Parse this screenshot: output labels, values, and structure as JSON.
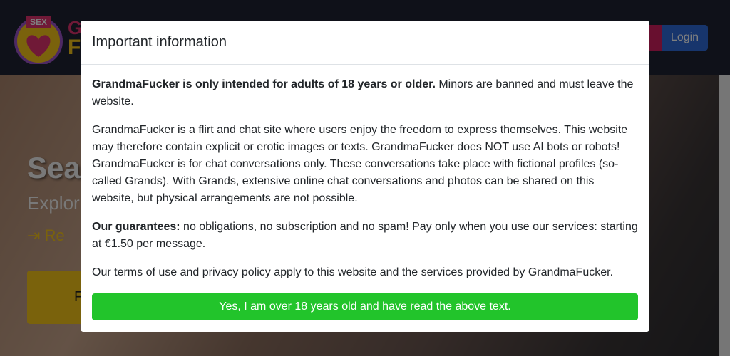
{
  "navbar": {
    "logo_badge": "SEX",
    "logo_text_line1": "G",
    "logo_text_line2": "F",
    "login_label": "Login"
  },
  "hero": {
    "title": "Sea",
    "subtitle": "Explor",
    "register_link": "Re",
    "cta_label": "F"
  },
  "modal": {
    "title": "Important information",
    "para1_bold": "GrandmaFucker is only intended for adults of 18 years or older.",
    "para1_rest": " Minors are banned and must leave the website.",
    "para2": "GrandmaFucker is a flirt and chat site where users enjoy the freedom to express themselves. This website may therefore contain explicit or erotic images or texts. GrandmaFucker does NOT use AI bots or robots! GrandmaFucker is for chat conversations only. These conversations take place with fictional profiles (so-called Grands). With Grands, extensive online chat conversations and photos can be shared on this website, but physical arrangements are not possible.",
    "para3_bold": "Our guarantees:",
    "para3_rest": " no obligations, no subscription and no spam! Pay only when you use our services: starting at €1.50 per message.",
    "para4": "Our terms of use and privacy policy apply to this website and the services provided by GrandmaFucker.",
    "confirm_label": "Yes, I am over 18 years old and have read the above text."
  },
  "colors": {
    "navbar_bg": "#1e2233",
    "brand_pink": "#e0336e",
    "brand_yellow": "#f5c518",
    "login_blue": "#2f6bd8",
    "confirm_green": "#22c42b"
  }
}
